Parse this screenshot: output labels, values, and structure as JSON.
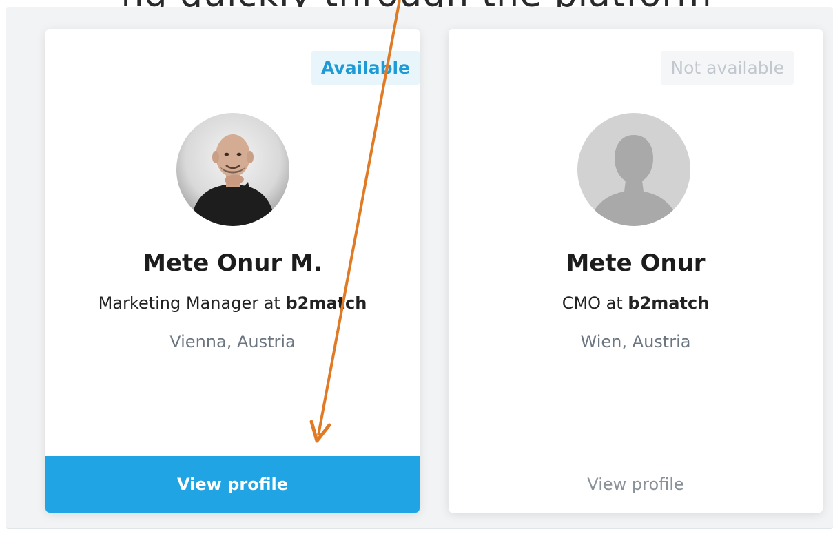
{
  "caption": "ng quickly through the platform",
  "colors": {
    "accent": "#21a4e3",
    "available_text": "#1e9bd6",
    "arrow": "#e07a24"
  },
  "cards": [
    {
      "status": "Available",
      "avatar_icon": "person-photo",
      "name": "Mete Onur M.",
      "role_prefix": "Marketing Manager at ",
      "company": "b2match",
      "location": "Vienna, Austria",
      "button": "View profile"
    },
    {
      "status": "Not available",
      "avatar_icon": "default-avatar-icon",
      "name": "Mete Onur",
      "role_prefix": "CMO at ",
      "company": "b2match",
      "location": "Wien, Austria",
      "button": "View profile"
    }
  ]
}
